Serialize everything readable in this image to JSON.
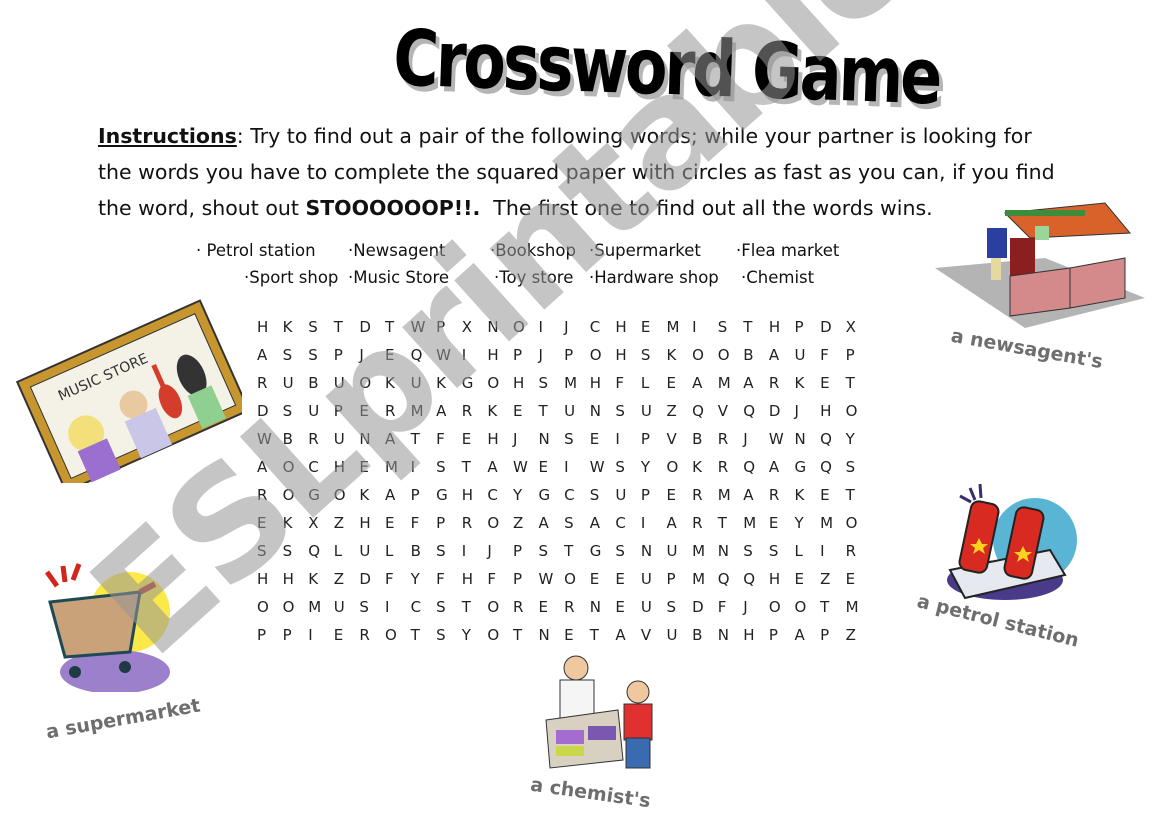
{
  "title": "Crossword Game",
  "instructions": {
    "lead": "Instructions",
    "line1": ": Try to find out a pair of the following words; while your partner is looking for",
    "line2": "the words you have to complete the squared paper with circles as fast as you can, if you find",
    "line3_a": "the word, shout out ",
    "shout": "STOOOOOOP!!.",
    "line3_b": "  The first one to find out all the words wins."
  },
  "word_list": [
    "· Petrol station",
    "·Newsagent",
    "·Bookshop",
    "·Supermarket",
    "·Flea market",
    "·Sport shop",
    "·Music Store",
    "·Toy store",
    "·Hardware shop",
    "·Chemist"
  ],
  "grid": [
    "HKSTDTWPXNOIJCHEMISTHPDX",
    "ASSPJEQWIHPJPOHSKOOBAUFP",
    "RUBUOKUKGOHSMHFLEAMARKET",
    "DSUPERMARKETUNSUZQVQDJHO",
    "WBRUNATFEHJNSEIPVBRJWNQY",
    "AOCHEMISTAWEIWSYOKRQAGQS",
    "ROGOKAPGHCYGCSUPERMARKET",
    "EKXZHEFPROZASACIARTMEYMO",
    "SSQLULBSIJPSTGSNUMNSSLIR",
    "HHKZDFYFHFPWOEEUPMQQHEZE",
    "OOMUSICSTORERNEUSDFJOOTM",
    "PPIEROTSYOTNETAVUBNHPAPZ"
  ],
  "illustrations": {
    "music_store": {
      "sign": "MUSIC STORE"
    },
    "newsagent": {
      "caption": "a newsagent's"
    },
    "petrol_station": {
      "caption": "a petrol station"
    },
    "supermarket": {
      "caption": "a supermarket"
    },
    "chemist": {
      "caption": "a chemist's"
    }
  },
  "watermark": "ESLprintables.com"
}
